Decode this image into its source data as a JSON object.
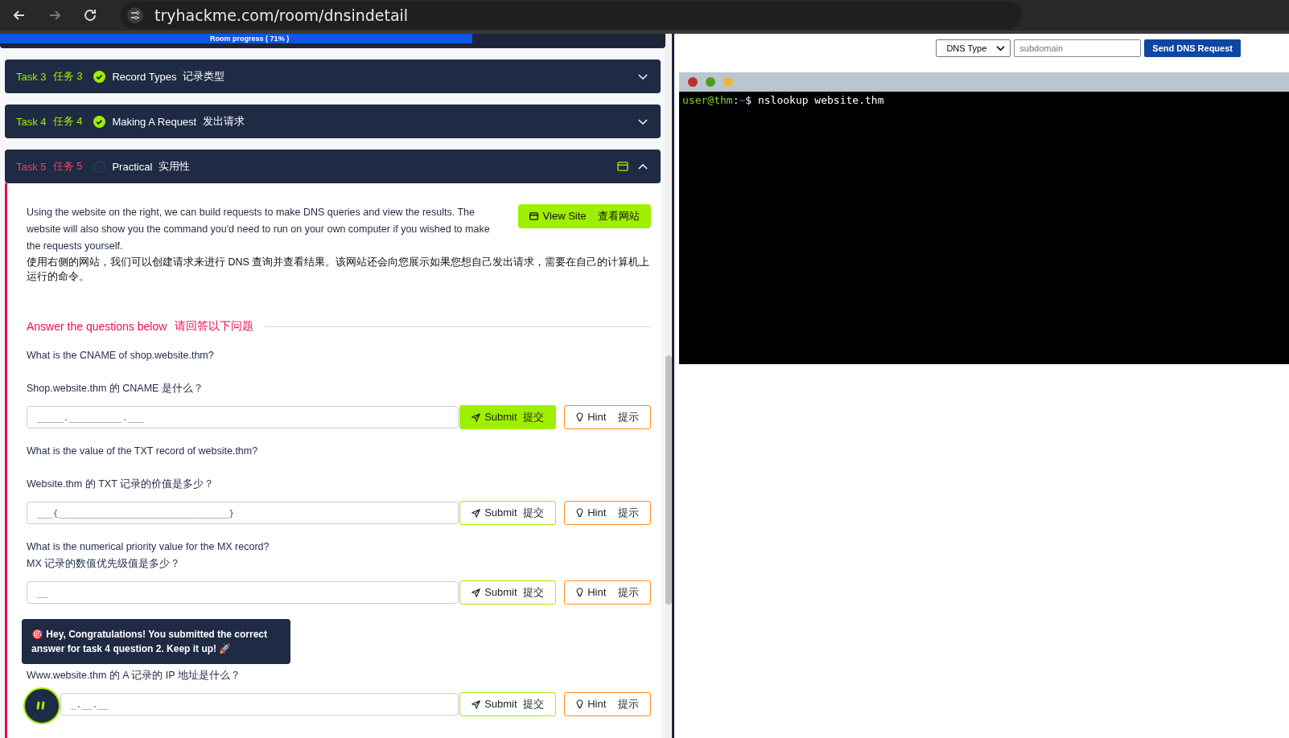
{
  "browser": {
    "url": "tryhackme.com/room/dnsindetail"
  },
  "progress": {
    "label": "Room progress ( 71% )",
    "level": 0.71
  },
  "tasks": [
    {
      "number": "Task 3",
      "number_zh": "任务 3",
      "title": "Record Types",
      "title_zh": "记录类型",
      "done": true,
      "expanded": false
    },
    {
      "number": "Task 4",
      "number_zh": "任务 4",
      "title": "Making A Request",
      "title_zh": "发出请求",
      "done": true,
      "expanded": false
    },
    {
      "number": "Task 5",
      "number_zh": "任务 5",
      "title": "Practical",
      "title_zh": "实用性",
      "done": false,
      "expanded": true
    }
  ],
  "content": {
    "paragraph": "Using the website on the right, we can build requests to make DNS queries and view the results. The website will also show you the command you'd need to run on your own computer if you wished to make the requests yourself.",
    "paragraph_zh": "使用右侧的网站，我们可以创建请求来进行 DNS 查询并查看结果。该网站还会向您展示如果您想自己发出请求，需要在自己的计算机上运行的命令。",
    "view_site": {
      "label": "View Site",
      "label_zh": "查看网站"
    },
    "answer_heading": "Answer the questions below",
    "answer_heading_zh": "请回答以下问题"
  },
  "questions": [
    {
      "question": "What is the CNAME of shop.website.thm?",
      "question_zh": "Shop.website.thm 的 CNAME 是什么？",
      "placeholder": "_____.__________.___",
      "answered": true,
      "submit": "Submit",
      "submit_zh": "提交",
      "hint": "Hint",
      "hint_zh": "提示"
    },
    {
      "question": "What is the value of the TXT record of website.thm?",
      "question_zh": "Website.thm 的 TXT 记录的价值是多少？",
      "placeholder": "___{________________________________}",
      "answered": false,
      "submit": "Submit",
      "submit_zh": "提交",
      "hint": "Hint",
      "hint_zh": "提示"
    },
    {
      "question": "What is the numerical priority value for the MX record?",
      "question_zh": "MX 记录的数值优先级值是多少？",
      "placeholder": "__",
      "answered": false,
      "submit": "Submit",
      "submit_zh": "提交",
      "hint": "Hint",
      "hint_zh": "提示"
    },
    {
      "question_zh": "Www.website.thm 的 A 记录的 IP 地址是什么？",
      "placeholder": "_.__.__",
      "answered": false,
      "submit": "Submit",
      "submit_zh": "提交",
      "hint": "Hint",
      "hint_zh": "提示"
    }
  ],
  "toast": {
    "message": "🎯 Hey, Congratulations! You submitted the correct answer for task 4 question 2. Keep it up! 🚀"
  },
  "dns_tool": {
    "type_select": "DNS Type",
    "subdomain_placeholder": "subdomain",
    "send": "Send DNS Request"
  },
  "terminal": {
    "user": "user@thm",
    "separator": ":",
    "path": "~",
    "command": "$ nslookup website.thm"
  }
}
